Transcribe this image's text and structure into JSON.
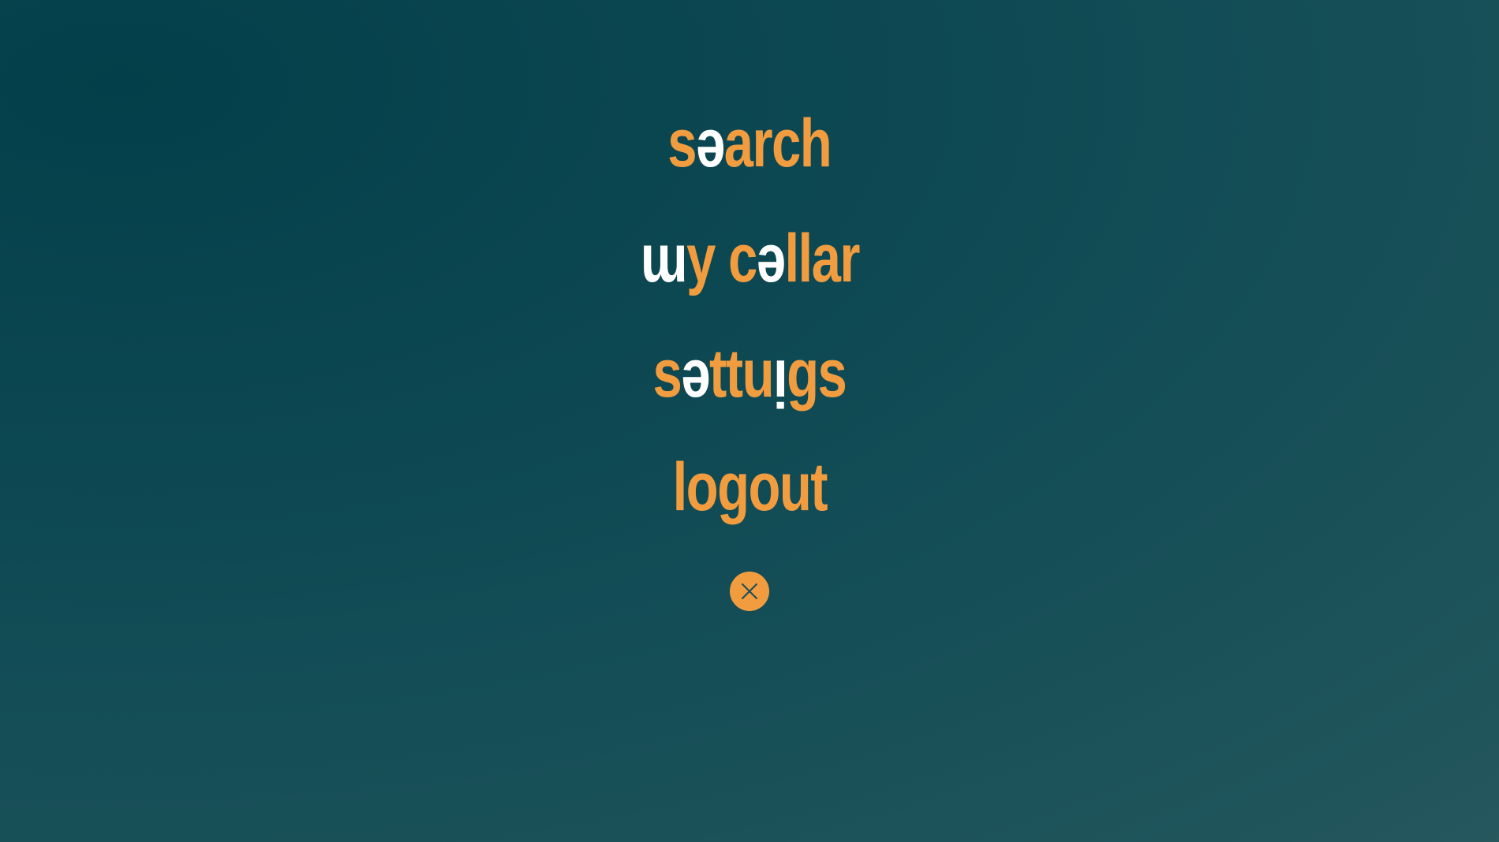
{
  "menu": {
    "items": [
      {
        "id": "search",
        "segments": [
          {
            "text": "s",
            "tone": "accent"
          },
          {
            "text": "ə",
            "tone": "light"
          },
          {
            "text": "arch",
            "tone": "accent"
          }
        ]
      },
      {
        "id": "my-cellar",
        "segments": [
          {
            "text": "ɯ",
            "tone": "light"
          },
          {
            "text": "y c",
            "tone": "accent"
          },
          {
            "text": "ə",
            "tone": "light"
          },
          {
            "text": "llar",
            "tone": "accent"
          }
        ]
      },
      {
        "id": "settings",
        "segments": [
          {
            "text": "s",
            "tone": "accent"
          },
          {
            "text": "ə",
            "tone": "light"
          },
          {
            "text": "ttu",
            "tone": "accent"
          },
          {
            "text": "ı̣",
            "tone": "light"
          },
          {
            "text": "gs",
            "tone": "accent"
          }
        ]
      },
      {
        "id": "logout",
        "segments": [
          {
            "text": "logout",
            "tone": "accent"
          }
        ]
      }
    ]
  },
  "close_button": {
    "icon": "close-icon"
  },
  "colors": {
    "accent": "#f29c40",
    "light": "#ffffff",
    "background_dark": "#033f4a",
    "background_light": "#386366"
  }
}
